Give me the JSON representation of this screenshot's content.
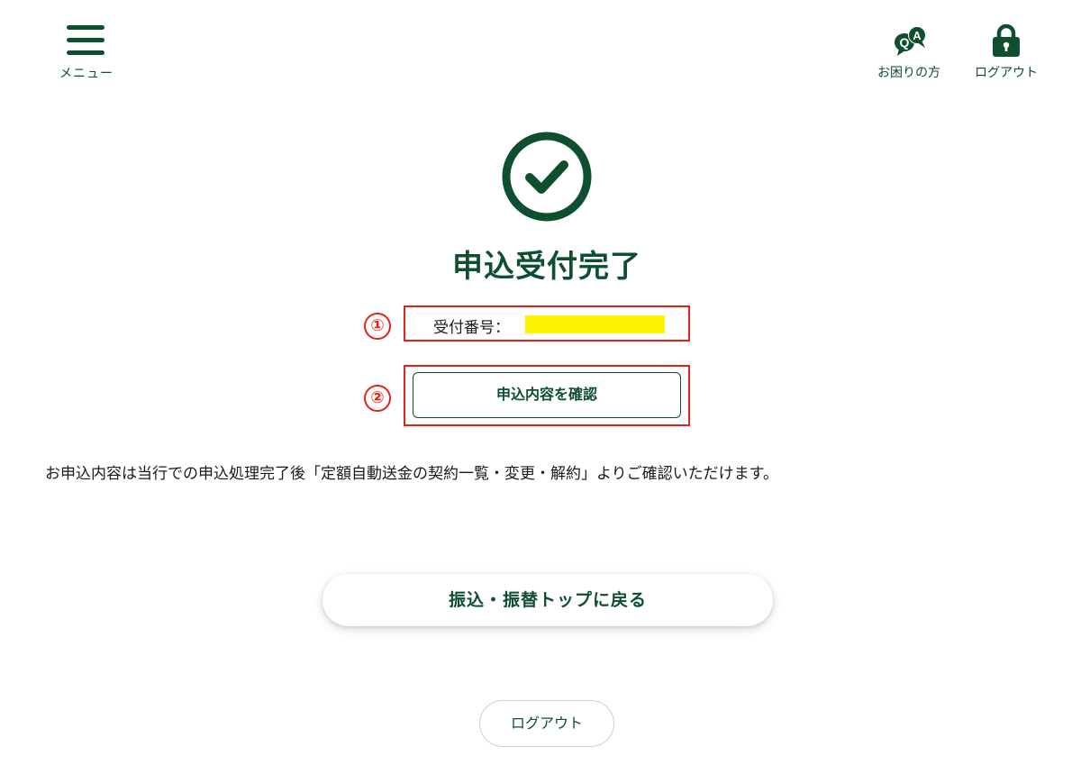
{
  "header": {
    "menu_label": "メニュー",
    "help_label": "お困りの方",
    "logout_label": "ログアウト",
    "qa_icon_letters": {
      "q": "Q",
      "a": "A"
    }
  },
  "completion": {
    "title": "申込受付完了",
    "receipt_label": "受付番号：",
    "confirm_button_label": "申込内容を確認",
    "info_text": "お申込内容は当行での申込処理完了後「定額自動送金の契約一覧・変更・解約」よりご確認いただけます。"
  },
  "annotations": {
    "marker_1": "①",
    "marker_2": "②"
  },
  "footer": {
    "back_button_label": "振込・振替トップに戻る",
    "logout_button_label": "ログアウト"
  },
  "colors": {
    "brand_green": "#0d4f2e",
    "annotation_red": "#e2231a",
    "redaction_yellow": "#fff200"
  }
}
